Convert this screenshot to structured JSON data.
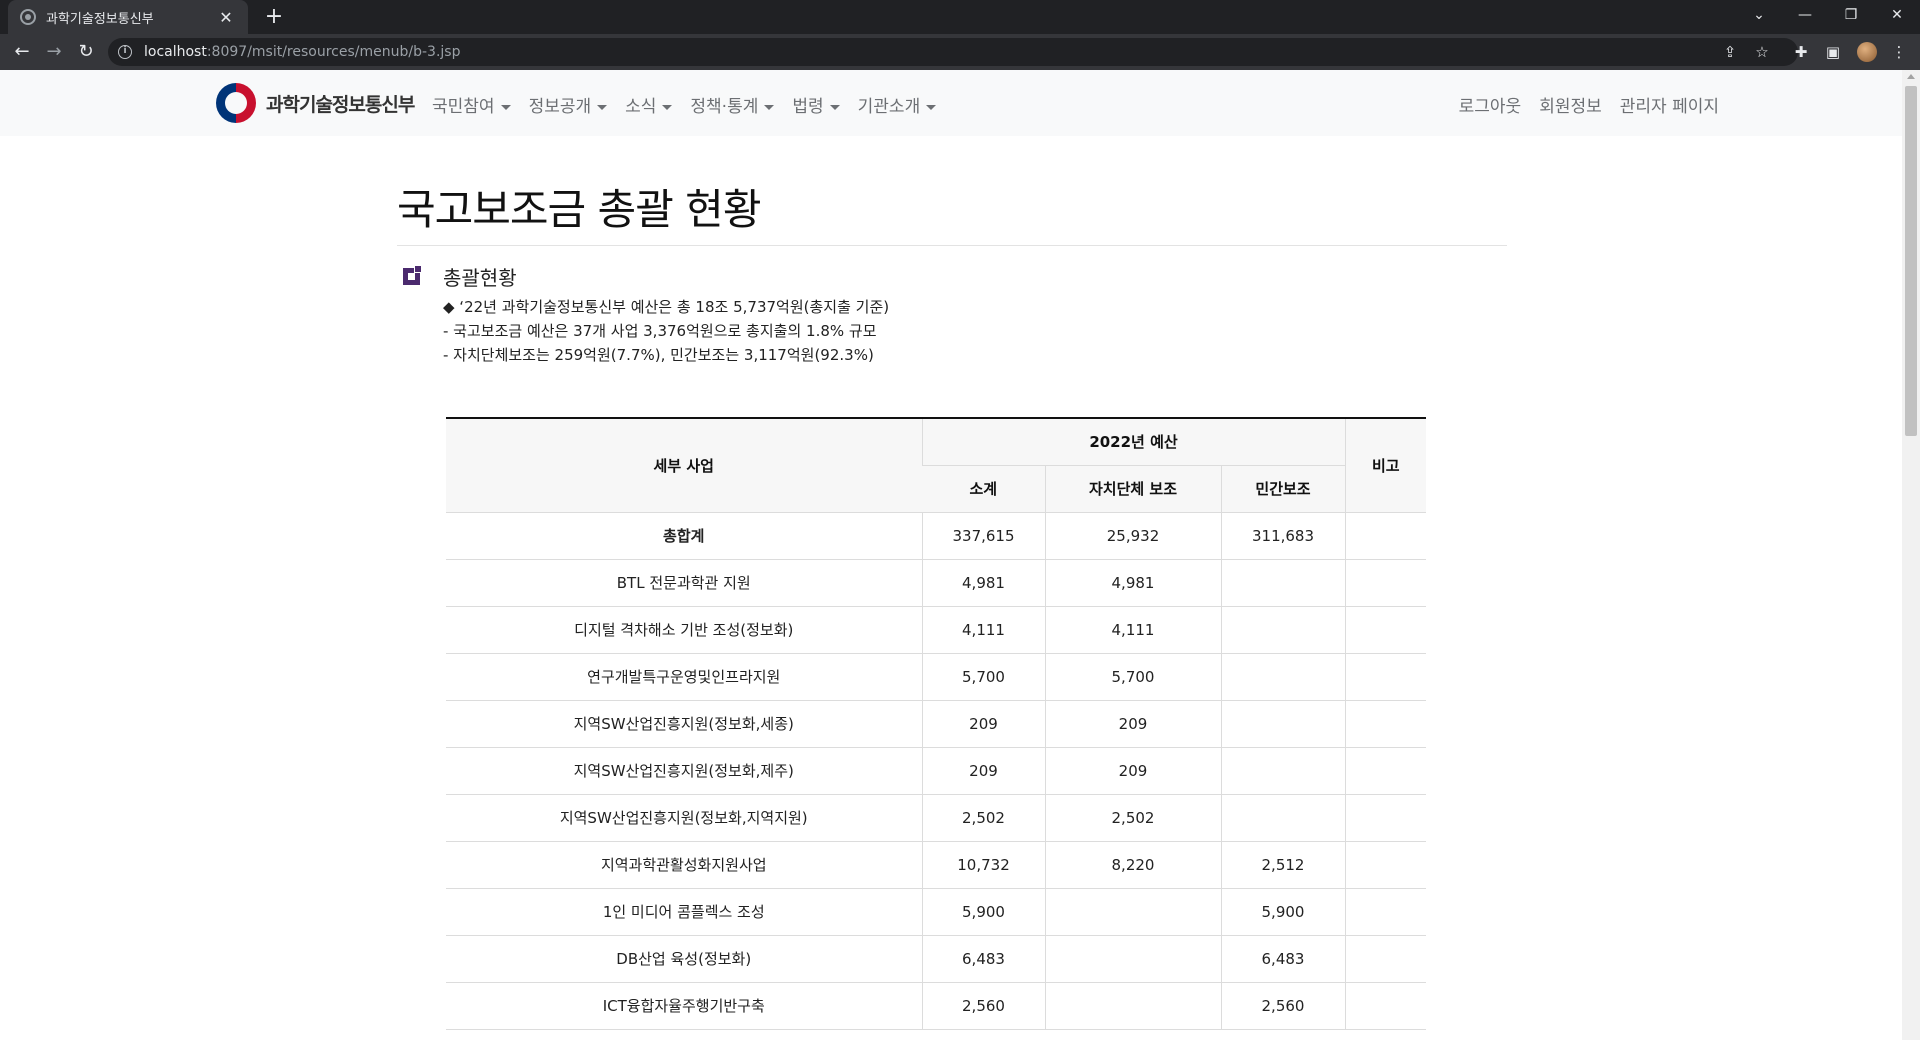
{
  "browser": {
    "tab_title": "과학기술정보통신부",
    "url_host": "localhost",
    "url_rest": ":8097/msit/resources/menub/b-3.jsp"
  },
  "site": {
    "logo_text": "과학기술정보통신부",
    "menu": [
      {
        "label": "국민참여"
      },
      {
        "label": "정보공개"
      },
      {
        "label": "소식"
      },
      {
        "label": "정책·통계"
      },
      {
        "label": "법령"
      },
      {
        "label": "기관소개"
      }
    ],
    "right_links": {
      "logout": "로그아웃",
      "member_info": "회원정보",
      "admin": "관리자 페이지"
    }
  },
  "page": {
    "title": "국고보조금 총괄 현황",
    "section_title": "총괄현황",
    "summary": [
      "◆ ‘22년 과학기술정보통신부 예산은 총 18조 5,737억원(총지출 기준)",
      "- 국고보조금 예산은 37개 사업 3,376억원으로 총지출의 1.8% 규모",
      "- 자치단체보조는 259억원(7.7%), 민간보조는 3,117억원(92.3%)"
    ]
  },
  "table": {
    "headers": {
      "project": "세부 사업",
      "budget_year": "2022년 예산",
      "subtotal": "소계",
      "local_gov": "자치단체 보조",
      "private": "민간보조",
      "remarks": "비고"
    },
    "rows": [
      {
        "name": "총합계",
        "subtotal": "337,615",
        "local": "25,932",
        "private": "311,683",
        "note": ""
      },
      {
        "name": "BTL 전문과학관 지원",
        "subtotal": "4,981",
        "local": "4,981",
        "private": "",
        "note": ""
      },
      {
        "name": "디지털 격차해소 기반 조성(정보화)",
        "subtotal": "4,111",
        "local": "4,111",
        "private": "",
        "note": ""
      },
      {
        "name": "연구개발특구운영및인프라지원",
        "subtotal": "5,700",
        "local": "5,700",
        "private": "",
        "note": ""
      },
      {
        "name": "지역SW산업진흥지원(정보화,세종)",
        "subtotal": "209",
        "local": "209",
        "private": "",
        "note": ""
      },
      {
        "name": "지역SW산업진흥지원(정보화,제주)",
        "subtotal": "209",
        "local": "209",
        "private": "",
        "note": ""
      },
      {
        "name": "지역SW산업진흥지원(정보화,지역지원)",
        "subtotal": "2,502",
        "local": "2,502",
        "private": "",
        "note": ""
      },
      {
        "name": "지역과학관활성화지원사업",
        "subtotal": "10,732",
        "local": "8,220",
        "private": "2,512",
        "note": ""
      },
      {
        "name": "1인 미디어 콤플렉스 조성",
        "subtotal": "5,900",
        "local": "",
        "private": "5,900",
        "note": ""
      },
      {
        "name": "DB산업 육성(정보화)",
        "subtotal": "6,483",
        "local": "",
        "private": "6,483",
        "note": ""
      },
      {
        "name": "ICT융합자율주행기반구축",
        "subtotal": "2,560",
        "local": "",
        "private": "2,560",
        "note": ""
      }
    ]
  }
}
